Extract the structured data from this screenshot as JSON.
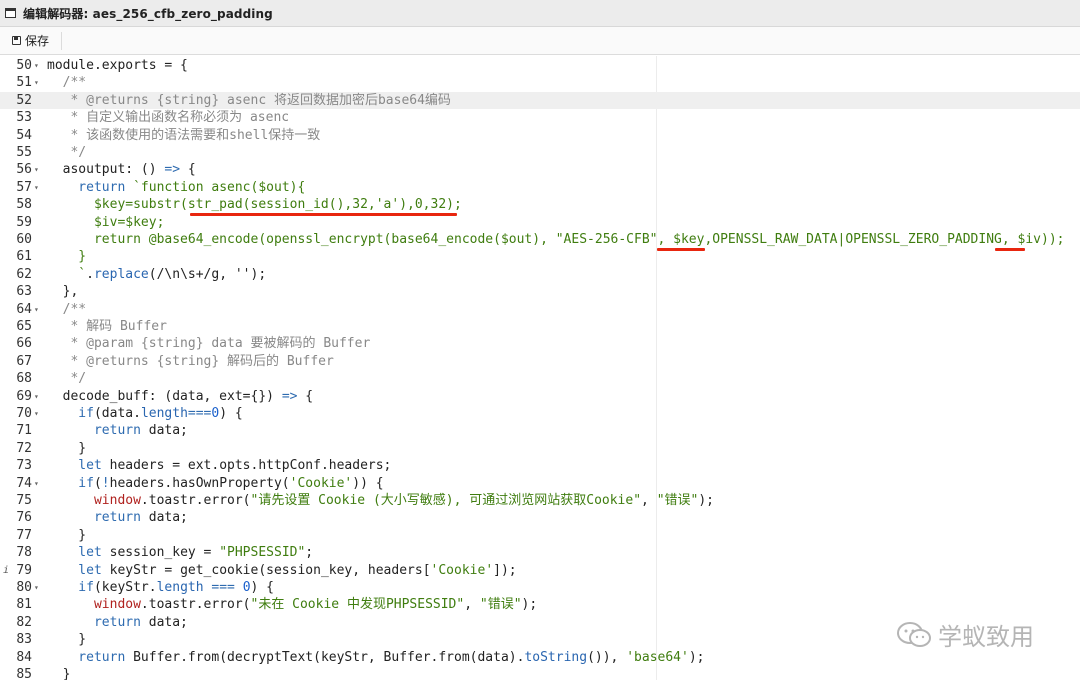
{
  "window": {
    "title": "编辑解码器: aes_256_cfb_zero_padding"
  },
  "toolbar": {
    "save_label": "保存"
  },
  "editor": {
    "active_line": 52,
    "lines": [
      {
        "n": "50",
        "fold": true,
        "tokens": [
          [
            "pl",
            "module.exports = {"
          ]
        ]
      },
      {
        "n": "51",
        "fold": true,
        "tokens": [
          [
            "cm",
            "  /**"
          ]
        ]
      },
      {
        "n": "52",
        "fold": false,
        "tokens": [
          [
            "cm",
            "   * @returns {string} asenc 将返回数据加密后base64编码"
          ]
        ]
      },
      {
        "n": "53",
        "fold": false,
        "tokens": [
          [
            "cm",
            "   * 自定义输出函数名称必须为 asenc"
          ]
        ]
      },
      {
        "n": "54",
        "fold": false,
        "tokens": [
          [
            "cm",
            "   * 该函数使用的语法需要和shell保持一致"
          ]
        ]
      },
      {
        "n": "55",
        "fold": false,
        "tokens": [
          [
            "cm",
            "   */"
          ]
        ]
      },
      {
        "n": "56",
        "fold": true,
        "tokens": [
          [
            "pl",
            "  asoutput: () "
          ],
          [
            "kw",
            "=>"
          ],
          [
            "pl",
            " {"
          ]
        ]
      },
      {
        "n": "57",
        "fold": true,
        "tokens": [
          [
            "kw",
            "    return"
          ],
          [
            "tpl",
            " `function asenc($out){"
          ]
        ]
      },
      {
        "n": "58",
        "fold": false,
        "tokens": [
          [
            "tpl",
            "      $key=substr(str_pad(session_id(),32,'a'),0,32);"
          ]
        ]
      },
      {
        "n": "59",
        "fold": false,
        "tokens": [
          [
            "tpl",
            "      $iv=$key;"
          ]
        ]
      },
      {
        "n": "60",
        "fold": false,
        "tokens": [
          [
            "tpl",
            "      return @base64_encode(openssl_encrypt(base64_encode($out), \"AES-256-CFB\", $key,OPENSSL_RAW_DATA|OPENSSL_ZERO_PADDING, $iv));"
          ]
        ]
      },
      {
        "n": "61",
        "fold": false,
        "tokens": [
          [
            "tpl",
            "    }"
          ]
        ]
      },
      {
        "n": "62",
        "fold": false,
        "tokens": [
          [
            "tpl",
            "    `"
          ],
          [
            "pl",
            "."
          ],
          [
            "pr",
            "replace"
          ],
          [
            "pl",
            "(/\\n\\s+/g, '');"
          ]
        ]
      },
      {
        "n": "63",
        "fold": false,
        "tokens": [
          [
            "pl",
            "  },"
          ]
        ]
      },
      {
        "n": "64",
        "fold": true,
        "tokens": [
          [
            "cm",
            "  /**"
          ]
        ]
      },
      {
        "n": "65",
        "fold": false,
        "tokens": [
          [
            "cm",
            "   * 解码 Buffer"
          ]
        ]
      },
      {
        "n": "66",
        "fold": false,
        "tokens": [
          [
            "cm",
            "   * @param {string} data 要被解码的 Buffer"
          ]
        ]
      },
      {
        "n": "67",
        "fold": false,
        "tokens": [
          [
            "cm",
            "   * @returns {string} 解码后的 Buffer"
          ]
        ]
      },
      {
        "n": "68",
        "fold": false,
        "tokens": [
          [
            "cm",
            "   */"
          ]
        ]
      },
      {
        "n": "69",
        "fold": true,
        "tokens": [
          [
            "pl",
            "  decode_buff: (data, ext={}) "
          ],
          [
            "kw",
            "=>"
          ],
          [
            "pl",
            " {"
          ]
        ]
      },
      {
        "n": "70",
        "fold": true,
        "tokens": [
          [
            "kw",
            "    if"
          ],
          [
            "pl",
            "(data."
          ],
          [
            "pr",
            "length"
          ],
          [
            "kw",
            "==="
          ],
          [
            "nu",
            "0"
          ],
          [
            "pl",
            ") {"
          ]
        ]
      },
      {
        "n": "71",
        "fold": false,
        "tokens": [
          [
            "kw",
            "      return"
          ],
          [
            "pl",
            " data;"
          ]
        ]
      },
      {
        "n": "72",
        "fold": false,
        "tokens": [
          [
            "pl",
            "    }"
          ]
        ]
      },
      {
        "n": "73",
        "fold": false,
        "tokens": [
          [
            "kw",
            "    let"
          ],
          [
            "pl",
            " headers = ext.opts.httpConf.headers;"
          ]
        ]
      },
      {
        "n": "74",
        "fold": true,
        "tokens": [
          [
            "kw",
            "    if"
          ],
          [
            "pl",
            "("
          ],
          [
            "kw",
            "!"
          ],
          [
            "pl",
            "headers.hasOwnProperty("
          ],
          [
            "st",
            "'Cookie'"
          ],
          [
            "pl",
            ")) {"
          ]
        ]
      },
      {
        "n": "75",
        "fold": false,
        "tokens": [
          [
            "ob",
            "      window"
          ],
          [
            "pl",
            ".toastr.error("
          ],
          [
            "st",
            "\"请先设置 Cookie (大小写敏感), 可通过浏览网站获取Cookie\""
          ],
          [
            "pl",
            ", "
          ],
          [
            "st",
            "\"错误\""
          ],
          [
            "pl",
            ");"
          ]
        ]
      },
      {
        "n": "76",
        "fold": false,
        "tokens": [
          [
            "kw",
            "      return"
          ],
          [
            "pl",
            " data;"
          ]
        ]
      },
      {
        "n": "77",
        "fold": false,
        "tokens": [
          [
            "pl",
            "    }"
          ]
        ]
      },
      {
        "n": "78",
        "fold": false,
        "tokens": [
          [
            "kw",
            "    let"
          ],
          [
            "pl",
            " session_key = "
          ],
          [
            "st",
            "\"PHPSESSID\""
          ],
          [
            "pl",
            ";"
          ]
        ]
      },
      {
        "n": "79",
        "fold": false,
        "info": true,
        "tokens": [
          [
            "kw",
            "    let"
          ],
          [
            "pl",
            " keyStr = get_cookie(session_key, headers["
          ],
          [
            "st",
            "'Cookie'"
          ],
          [
            "pl",
            "]);"
          ]
        ]
      },
      {
        "n": "80",
        "fold": true,
        "tokens": [
          [
            "kw",
            "    if"
          ],
          [
            "pl",
            "(keyStr."
          ],
          [
            "pr",
            "length"
          ],
          [
            "kw",
            " === "
          ],
          [
            "nu",
            "0"
          ],
          [
            "pl",
            ") {"
          ]
        ]
      },
      {
        "n": "81",
        "fold": false,
        "tokens": [
          [
            "ob",
            "      window"
          ],
          [
            "pl",
            ".toastr.error("
          ],
          [
            "st",
            "\"未在 Cookie 中发现PHPSESSID\""
          ],
          [
            "pl",
            ", "
          ],
          [
            "st",
            "\"错误\""
          ],
          [
            "pl",
            ");"
          ]
        ]
      },
      {
        "n": "82",
        "fold": false,
        "tokens": [
          [
            "kw",
            "      return"
          ],
          [
            "pl",
            " data;"
          ]
        ]
      },
      {
        "n": "83",
        "fold": false,
        "tokens": [
          [
            "pl",
            "    }"
          ]
        ]
      },
      {
        "n": "84",
        "fold": false,
        "tokens": [
          [
            "kw",
            "    return"
          ],
          [
            "pl",
            " Buffer.from(decryptText(keyStr, Buffer.from(data)."
          ],
          [
            "pr",
            "toString"
          ],
          [
            "pl",
            "()), "
          ],
          [
            "st",
            "'base64'"
          ],
          [
            "pl",
            ");"
          ]
        ]
      },
      {
        "n": "85",
        "fold": false,
        "tokens": [
          [
            "pl",
            "  }"
          ]
        ]
      }
    ]
  },
  "watermark": {
    "text": "学蚁致用",
    "icon": "wechat-icon"
  },
  "colors": {
    "underline": "#e8260f",
    "comment": "#888888",
    "keyword": "#2e6bb0",
    "string": "#3f7d0f"
  }
}
